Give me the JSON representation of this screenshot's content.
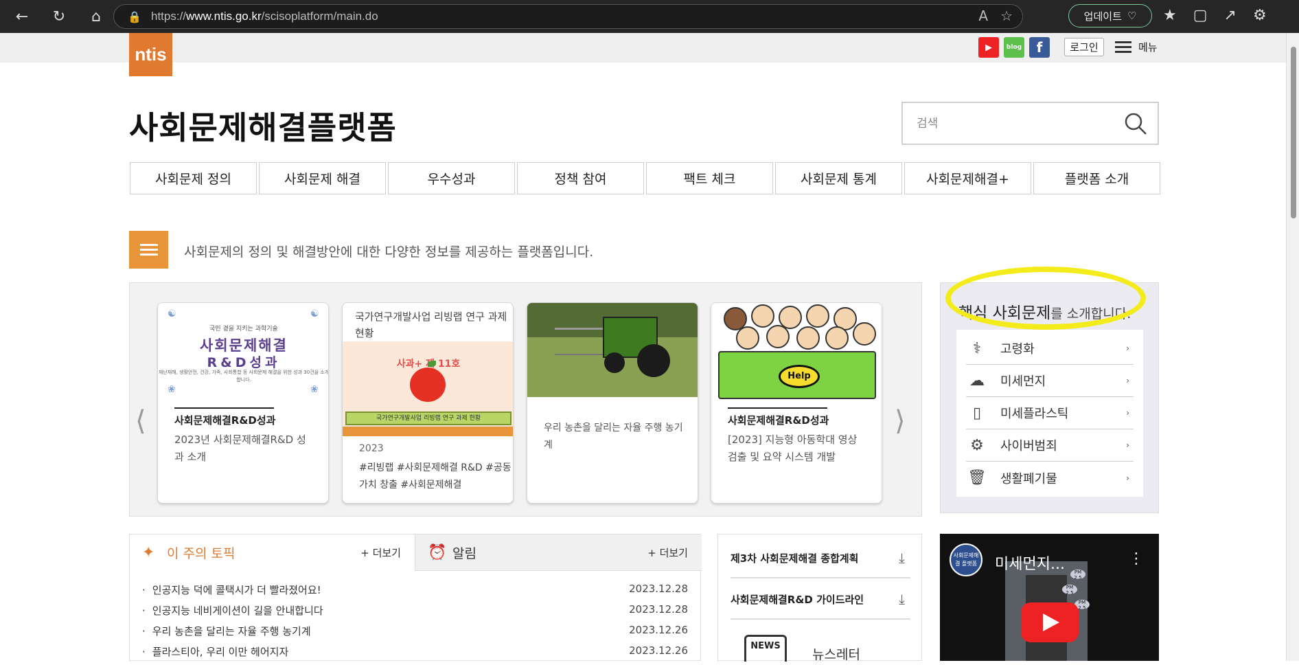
{
  "browser": {
    "url_prefix": "https://",
    "url_domain": "www.ntis.go.kr",
    "url_path": "/scisoplatform/main.do",
    "update_label": "업데이트"
  },
  "header": {
    "logo_text": "ntis",
    "social": [
      "youtube",
      "blog",
      "facebook"
    ],
    "blog_label": "blog",
    "login_label": "로그인",
    "menu_label": "메뉴"
  },
  "site_title": "사회문제해결플랫폼",
  "search": {
    "placeholder": "검색"
  },
  "gnb": [
    "사회문제 정의",
    "사회문제 해결",
    "우수성과",
    "정책 참여",
    "팩트 체크",
    "사회문제 통계",
    "사회문제해결+",
    "플랫폼 소개"
  ],
  "intro_text": "사회문제의 정의 및 해결방안에 대한 다양한 정보를 제공하는 플랫폼입니다.",
  "cards": [
    {
      "img_line1": "국민 곁을 지키는 과학기술",
      "img_line2": "사회문제해결",
      "img_line3": "R&D성과",
      "img_line4": "재난재해, 생활안전, 건강, 가족, 사회통합 등 사회문제 해결을 위한 성과 30건을 소개합니다.",
      "category": "사회문제해결R&D성과",
      "desc": "2023년 사회문제해결R&D 성과 소개"
    },
    {
      "head": "국가연구개발사업 리빙랩 연구 과제 현황",
      "img_title": "사과+ 제 11호",
      "img_bar": "국가연구개발사업 리빙랩 연구 과제 현황",
      "year": "2023",
      "tags": "#리빙랩 #사회문제해결 R&D #공동가치 창출 #사회문제해결"
    },
    {
      "desc": "우리 농촌을 달리는 자율 주행 농기계"
    },
    {
      "img_help": "Help",
      "category": "사회문제해결R&D성과",
      "desc": "[2023] 지능형 아동학대 영상 검출 및 요약 시스템 개발"
    }
  ],
  "core_issues": {
    "title_main": "핵심 사회문제",
    "title_rest": "를 소개합니다.",
    "items": [
      {
        "label": "고령화",
        "icon": "elderly-icon"
      },
      {
        "label": "미세먼지",
        "icon": "dust-icon"
      },
      {
        "label": "미세플라스틱",
        "icon": "plastic-bottle-icon"
      },
      {
        "label": "사이버범죄",
        "icon": "hacker-icon"
      },
      {
        "label": "생활폐기물",
        "icon": "trash-icon"
      }
    ]
  },
  "tabs": {
    "topic_title": "이 주의 토픽",
    "notice_title": "알림",
    "more_label": "+ 더보기",
    "topics": [
      {
        "title": "인공지능 덕에 콜택시가 더 빨라졌어요!",
        "date": "2023.12.28"
      },
      {
        "title": "인공지능 네비게이션이 길을 안내합니다",
        "date": "2023.12.28"
      },
      {
        "title": "우리 농촌을 달리는 자율 주행 농기계",
        "date": "2023.12.26"
      },
      {
        "title": "플라스티아, 우리 이만 헤어지자",
        "date": "2023.12.26"
      }
    ]
  },
  "docs": {
    "items": [
      "제3차 사회문제해결 종합계획",
      "사회문제해결R&D 가이드라인"
    ],
    "news_icon_text": "NEWS",
    "newsletter": "뉴스레터"
  },
  "video": {
    "channel_label": "사회문제해결 플랫폼",
    "title": "미세먼지...",
    "pm_label": "PM 2.5"
  }
}
